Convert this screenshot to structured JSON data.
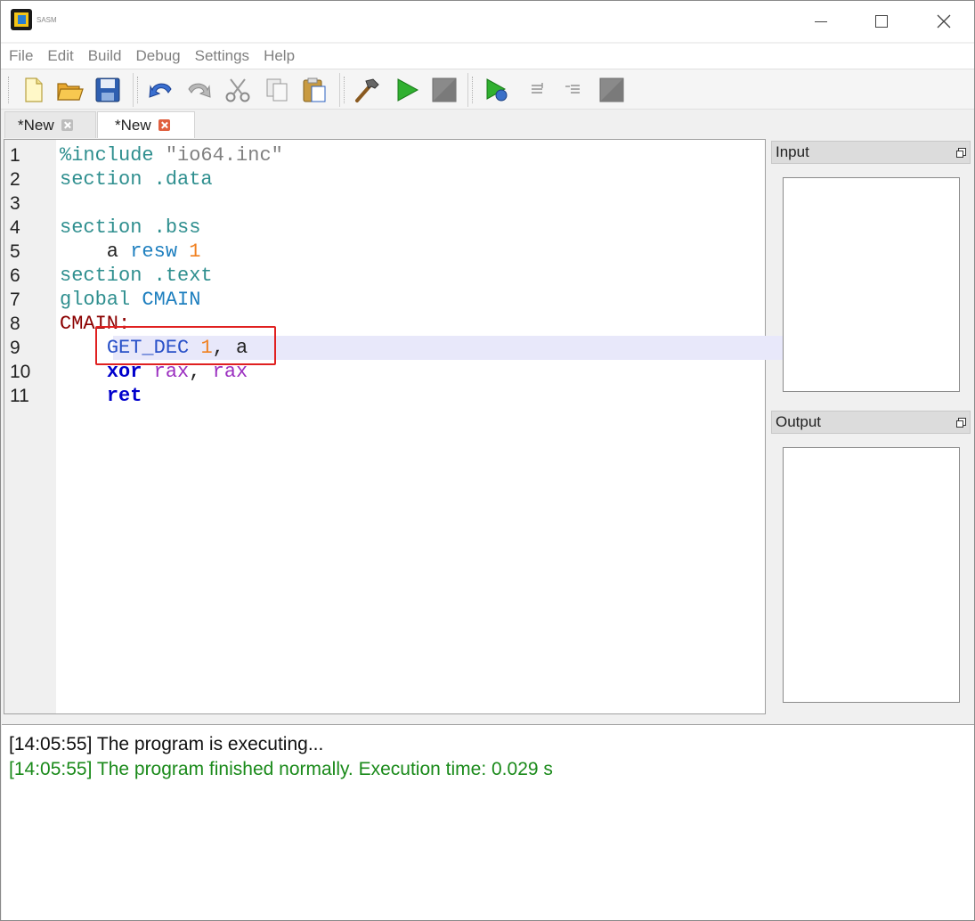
{
  "window": {
    "title": "SASM"
  },
  "menu": {
    "items": [
      "File",
      "Edit",
      "Build",
      "Debug",
      "Settings",
      "Help"
    ]
  },
  "toolbar": {
    "buttons": [
      "new-file-icon",
      "open-folder-icon",
      "save-icon",
      "undo-icon",
      "redo-icon",
      "cut-icon",
      "copy-icon",
      "paste-icon",
      "build-hammer-icon",
      "run-icon",
      "stop-icon",
      "debug-icon",
      "step-over-icon",
      "step-into-icon",
      "debug-stop-icon"
    ]
  },
  "tabs": [
    {
      "label": "*New",
      "active": false
    },
    {
      "label": "*New",
      "active": true
    }
  ],
  "editor": {
    "current_line": 9,
    "lines": [
      {
        "n": "1",
        "tokens": [
          {
            "t": "%include ",
            "c": "c-dir"
          },
          {
            "t": "\"io64.inc\"",
            "c": "c-str"
          }
        ]
      },
      {
        "n": "2",
        "tokens": [
          {
            "t": "section .data",
            "c": "c-sec"
          }
        ]
      },
      {
        "n": "3",
        "tokens": []
      },
      {
        "n": "4",
        "tokens": [
          {
            "t": "section .bss",
            "c": "c-sec"
          }
        ]
      },
      {
        "n": "5",
        "tokens": [
          {
            "t": "    a ",
            "c": "c-plain"
          },
          {
            "t": "resw",
            "c": "c-kw"
          },
          {
            "t": " ",
            "c": "c-plain"
          },
          {
            "t": "1",
            "c": "c-num"
          }
        ]
      },
      {
        "n": "6",
        "tokens": [
          {
            "t": "section .text",
            "c": "c-sec"
          }
        ]
      },
      {
        "n": "7",
        "tokens": [
          {
            "t": "global ",
            "c": "c-sec"
          },
          {
            "t": "CMAIN",
            "c": "c-kw"
          }
        ]
      },
      {
        "n": "8",
        "tokens": [
          {
            "t": "CMAIN:",
            "c": "c-label"
          }
        ]
      },
      {
        "n": "9",
        "tokens": [
          {
            "t": "    ",
            "c": "c-plain"
          },
          {
            "t": "GET_DEC",
            "c": "c-macro"
          },
          {
            "t": " ",
            "c": "c-plain"
          },
          {
            "t": "1",
            "c": "c-num"
          },
          {
            "t": ", a",
            "c": "c-plain"
          }
        ]
      },
      {
        "n": "10",
        "tokens": [
          {
            "t": "    ",
            "c": "c-plain"
          },
          {
            "t": "xor",
            "c": "c-bold"
          },
          {
            "t": " ",
            "c": "c-plain"
          },
          {
            "t": "rax",
            "c": "c-reg"
          },
          {
            "t": ", ",
            "c": "c-plain"
          },
          {
            "t": "rax",
            "c": "c-reg"
          }
        ]
      },
      {
        "n": "11",
        "tokens": [
          {
            "t": "    ",
            "c": "c-plain"
          },
          {
            "t": "ret",
            "c": "c-bold"
          }
        ]
      }
    ]
  },
  "panels": {
    "input_title": "Input",
    "output_title": "Output"
  },
  "log": [
    {
      "text": "[14:05:55] The program is executing...",
      "style": "log-normal"
    },
    {
      "text": "[14:05:55] The program finished normally. Execution time: 0.029 s",
      "style": "log-green"
    }
  ],
  "colors": {
    "highlight_box": "#e02020",
    "current_line": "#e8e8fa",
    "success_log": "#1a8a1a"
  }
}
